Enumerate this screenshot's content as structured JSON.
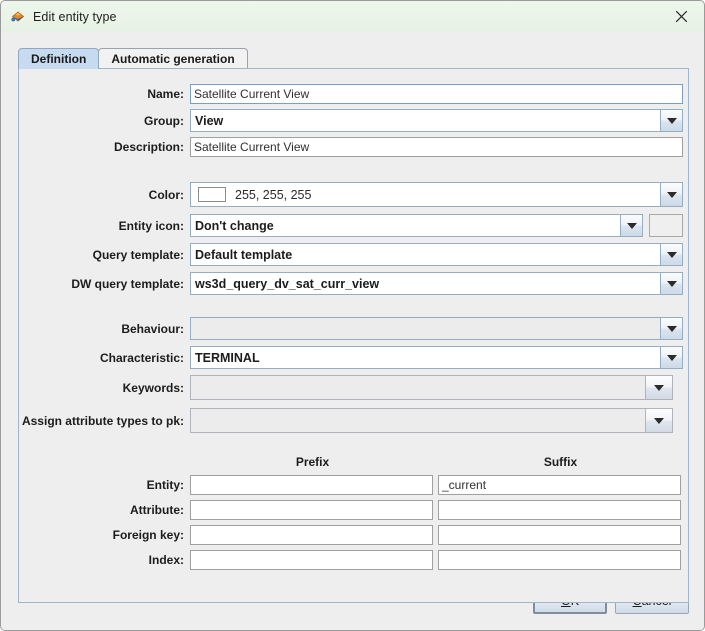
{
  "window": {
    "title": "Edit entity type",
    "icon": "app-gem-icon",
    "close_label": "×"
  },
  "tabs": [
    {
      "label": "Definition",
      "selected": true
    },
    {
      "label": "Automatic generation",
      "selected": false
    }
  ],
  "form": {
    "name": {
      "label": "Name:",
      "value": "Satellite Current View",
      "type": "text"
    },
    "group": {
      "label": "Group:",
      "value": "View",
      "type": "combo"
    },
    "description": {
      "label": "Description:",
      "value": "Satellite Current View",
      "type": "text"
    },
    "color": {
      "label": "Color:",
      "value": "255, 255, 255",
      "swatch_hex": "#ffffff",
      "type": "combo"
    },
    "entity_icon": {
      "label": "Entity icon:",
      "value": "Don't change",
      "type": "combo"
    },
    "query_template": {
      "label": "Query template:",
      "value": "Default template",
      "type": "combo"
    },
    "dw_query_template": {
      "label": "DW query template:",
      "value": "ws3d_query_dv_sat_curr_view",
      "type": "combo"
    },
    "behaviour": {
      "label": "Behaviour:",
      "value": "",
      "type": "combo"
    },
    "characteristic": {
      "label": "Characteristic:",
      "value": "TERMINAL",
      "type": "combo"
    },
    "keywords": {
      "label": "Keywords:",
      "value": "",
      "type": "combo"
    },
    "assign_attribute_types": {
      "label": "Assign attribute types to pk:",
      "value": "",
      "type": "combo"
    }
  },
  "affixes": {
    "prefix_header": "Prefix",
    "suffix_header": "Suffix",
    "rows": [
      {
        "label": "Entity:",
        "prefix": "",
        "suffix": "_current"
      },
      {
        "label": "Attribute:",
        "prefix": "",
        "suffix": ""
      },
      {
        "label": "Foreign key:",
        "prefix": "",
        "suffix": ""
      },
      {
        "label": "Index:",
        "prefix": "",
        "suffix": ""
      }
    ]
  },
  "buttons": {
    "ok": {
      "label": "OK",
      "mnemonic": "O",
      "default": true
    },
    "cancel": {
      "label": "Cancel",
      "mnemonic": "C",
      "default": false
    }
  },
  "colors": {
    "titlebar": "#eaf4e8",
    "panel_bg": "#eeeeee",
    "tab_selected": "#c6dbf0",
    "accent": "#5b8fc9"
  }
}
